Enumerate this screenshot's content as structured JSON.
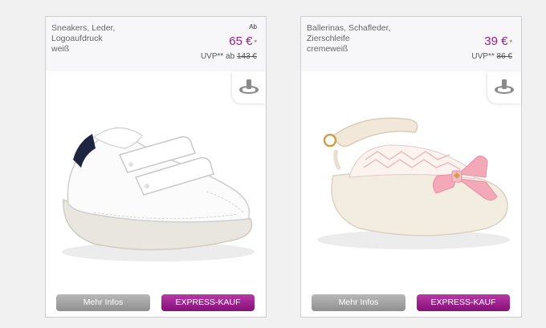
{
  "products": [
    {
      "name": "Sneakers, Leder, Logoaufdruck",
      "color": "weiß",
      "price_prefix": "Ab",
      "price": "65 €",
      "price_star": "*",
      "uvp_label": "UVP** ab",
      "uvp_value": "143 €",
      "icon": "rotate-360-icon",
      "more_info_label": "Mehr Infos",
      "express_label": "EXPRESS-KAUF"
    },
    {
      "name": "Ballerinas, Schafleder, Zierschleife",
      "color": "cremeweiß",
      "price": "39 €",
      "price_star": "*",
      "uvp_label": "UVP**",
      "uvp_value": "86 €",
      "icon": "rotate-360-icon",
      "more_info_label": "Mehr Infos",
      "express_label": "EXPRESS-KAUF"
    }
  ],
  "colors": {
    "price": "#9b1c8c",
    "express_button": "#9b1c8c",
    "info_button": "#a8a8a8"
  }
}
